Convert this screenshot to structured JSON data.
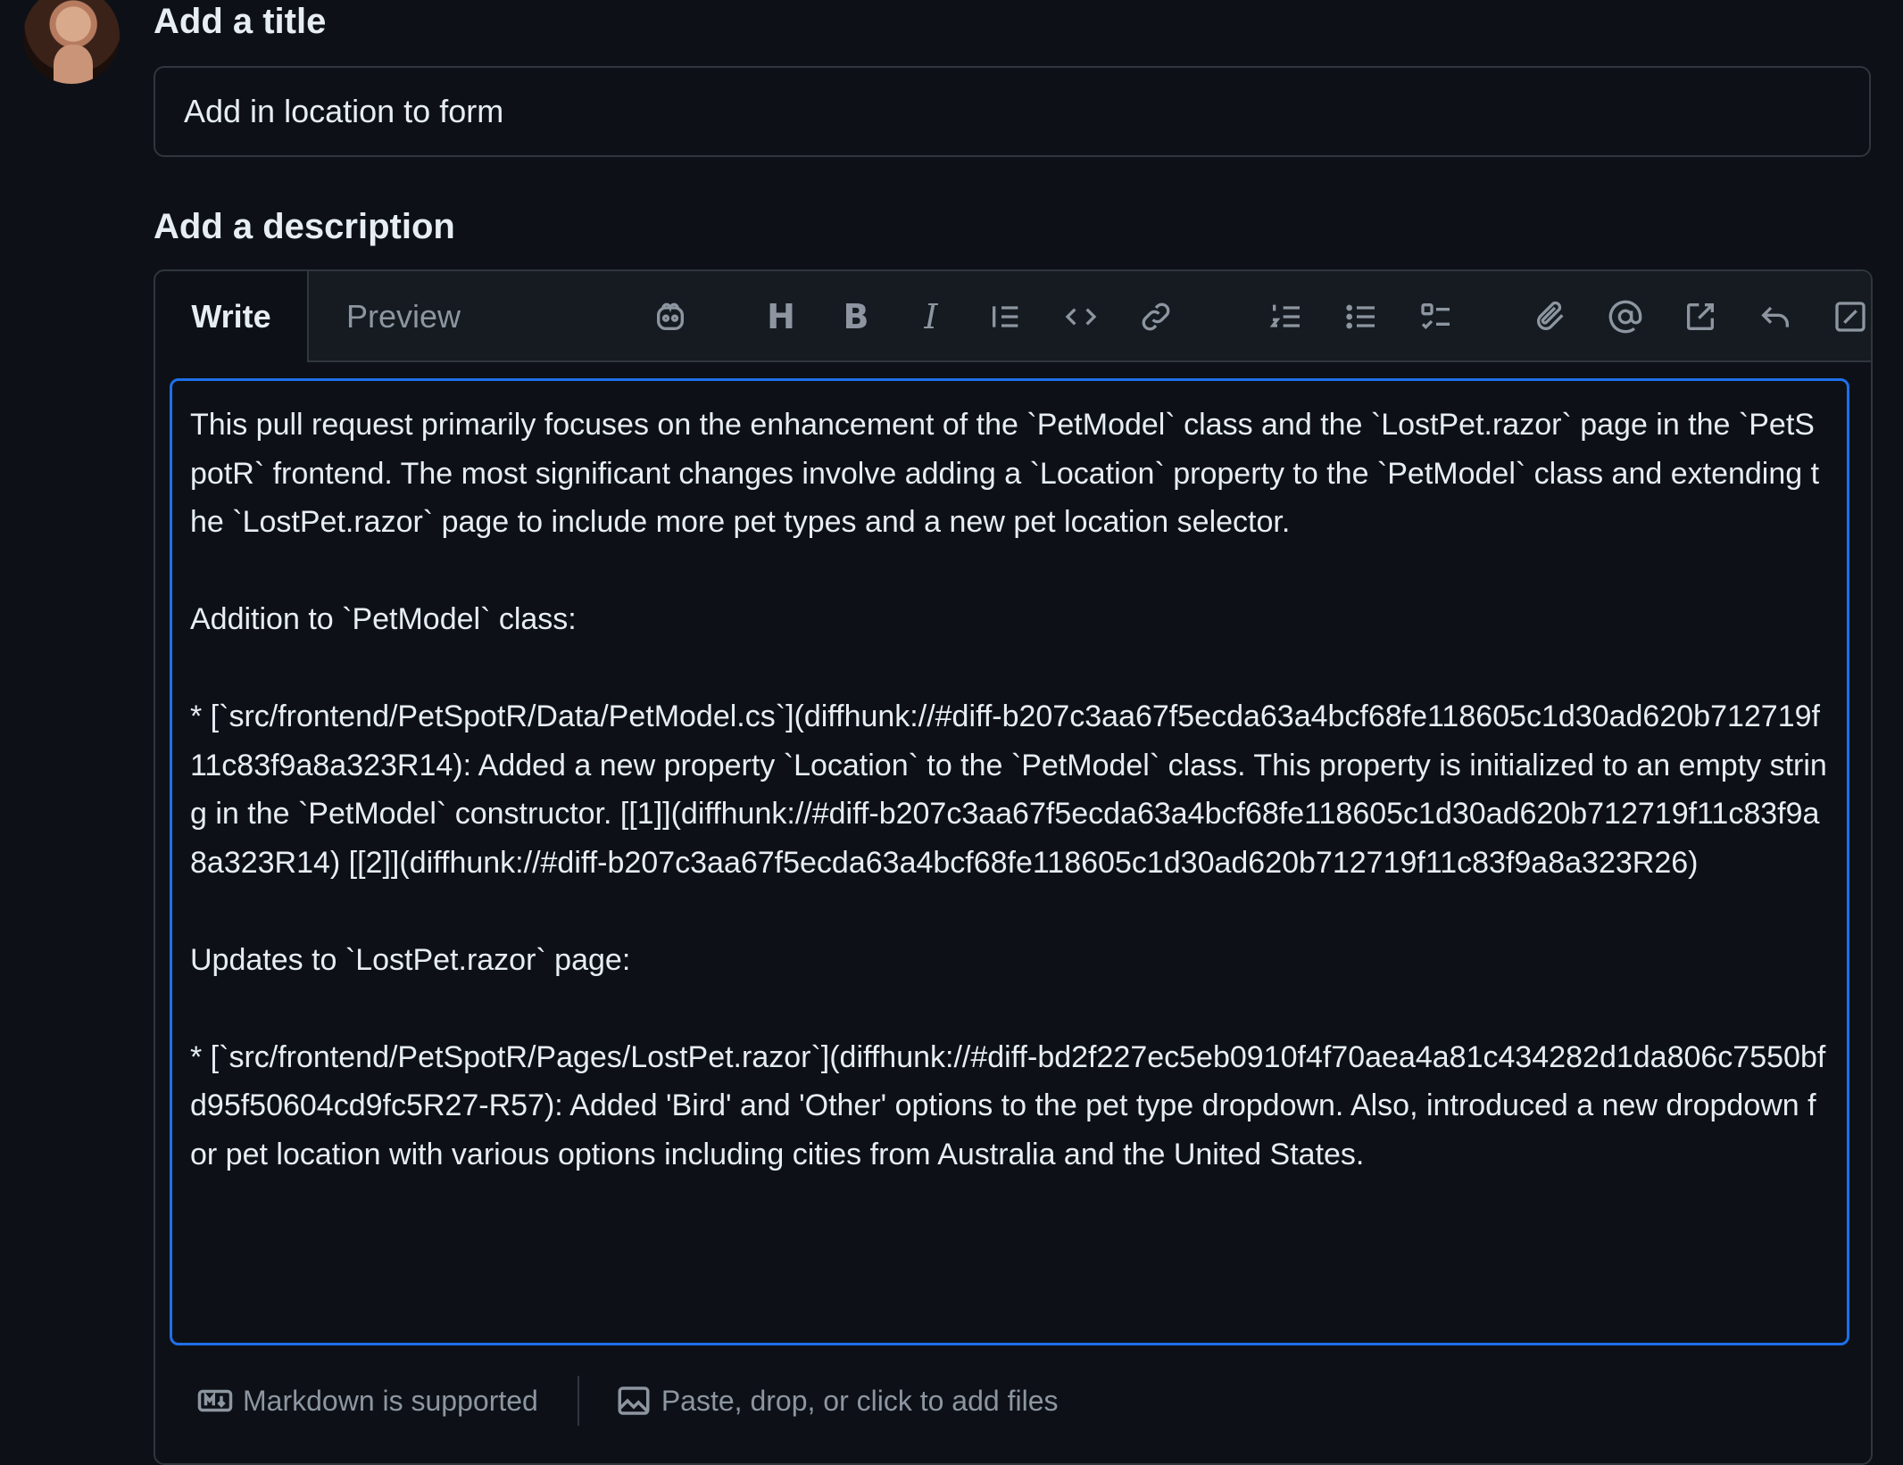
{
  "title_section": {
    "label": "Add a title",
    "value": "Add in location to form"
  },
  "description_section": {
    "label": "Add a description"
  },
  "tabs": {
    "write": "Write",
    "preview": "Preview"
  },
  "toolbar": {
    "icons": [
      "copilot-icon",
      "heading-icon",
      "bold-icon",
      "italic-icon",
      "quote-icon",
      "code-icon",
      "link-icon",
      "ordered-list-icon",
      "unordered-list-icon",
      "task-list-icon",
      "attach-icon",
      "mention-icon",
      "reference-icon",
      "undo-icon",
      "fullscreen-icon"
    ],
    "heading_glyph": "H",
    "bold_glyph": "B",
    "italic_glyph": "I"
  },
  "body": {
    "text": "This pull request primarily focuses on the enhancement of the `PetModel` class and the `LostPet.razor` page in the `PetSpotR` frontend. The most significant changes involve adding a `Location` property to the `PetModel` class and extending the `LostPet.razor` page to include more pet types and a new pet location selector.\n\nAddition to `PetModel` class:\n\n* [`src/frontend/PetSpotR/Data/PetModel.cs`](diffhunk://#diff-b207c3aa67f5ecda63a4bcf68fe118605c1d30ad620b712719f11c83f9a8a323R14): Added a new property `Location` to the `PetModel` class. This property is initialized to an empty string in the `PetModel` constructor. [[1]](diffhunk://#diff-b207c3aa67f5ecda63a4bcf68fe118605c1d30ad620b712719f11c83f9a8a323R14) [[2]](diffhunk://#diff-b207c3aa67f5ecda63a4bcf68fe118605c1d30ad620b712719f11c83f9a8a323R26)\n\nUpdates to `LostPet.razor` page:\n\n* [`src/frontend/PetSpotR/Pages/LostPet.razor`](diffhunk://#diff-bd2f227ec5eb0910f4f70aea4a81c434282d1da806c7550bfd95f50604cd9fc5R27-R57): Added 'Bird' and 'Other' options to the pet type dropdown. Also, introduced a new dropdown for pet location with various options including cities from Australia and the United States."
  },
  "footer": {
    "markdown": "Markdown is supported",
    "files": "Paste, drop, or click to add files"
  },
  "colors": {
    "background": "#0d1117",
    "focus_border": "#1f6feb",
    "muted_text": "#8d96a0"
  }
}
